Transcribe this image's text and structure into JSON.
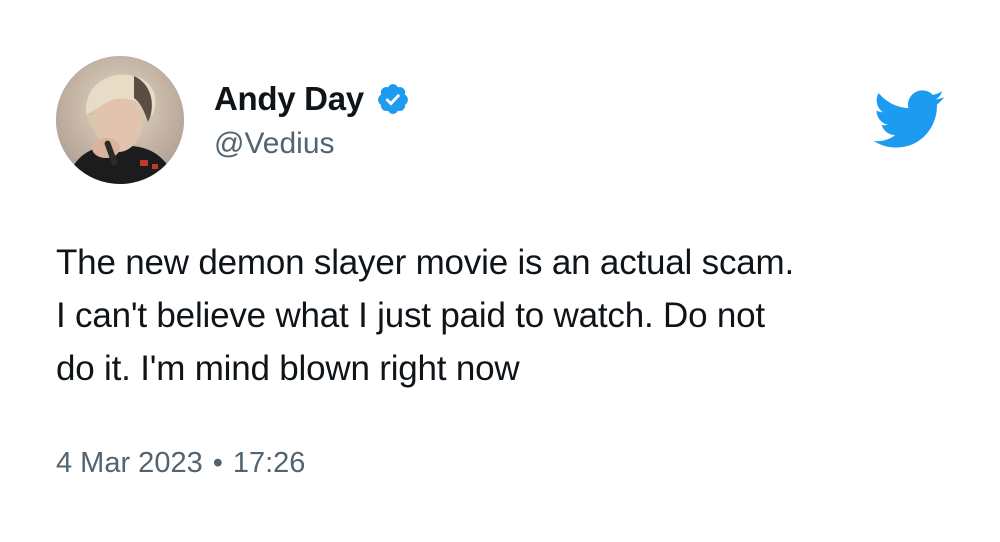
{
  "author": {
    "display_name": "Andy Day",
    "handle": "@Vedius",
    "verified": true,
    "avatar_icon": "user-avatar-photo"
  },
  "tweet": {
    "lines": [
      "The new demon slayer movie is an actual scam.",
      "I can't believe what I just paid to watch. Do not",
      "do it. I'm mind blown right now"
    ],
    "date": "4 Mar 2023",
    "separator": "•",
    "time": "17:26"
  },
  "branding": {
    "logo_icon": "twitter-bird-icon",
    "twitter_blue": "#1d9bf0",
    "text_primary": "#0f1419",
    "text_secondary": "#536471"
  }
}
